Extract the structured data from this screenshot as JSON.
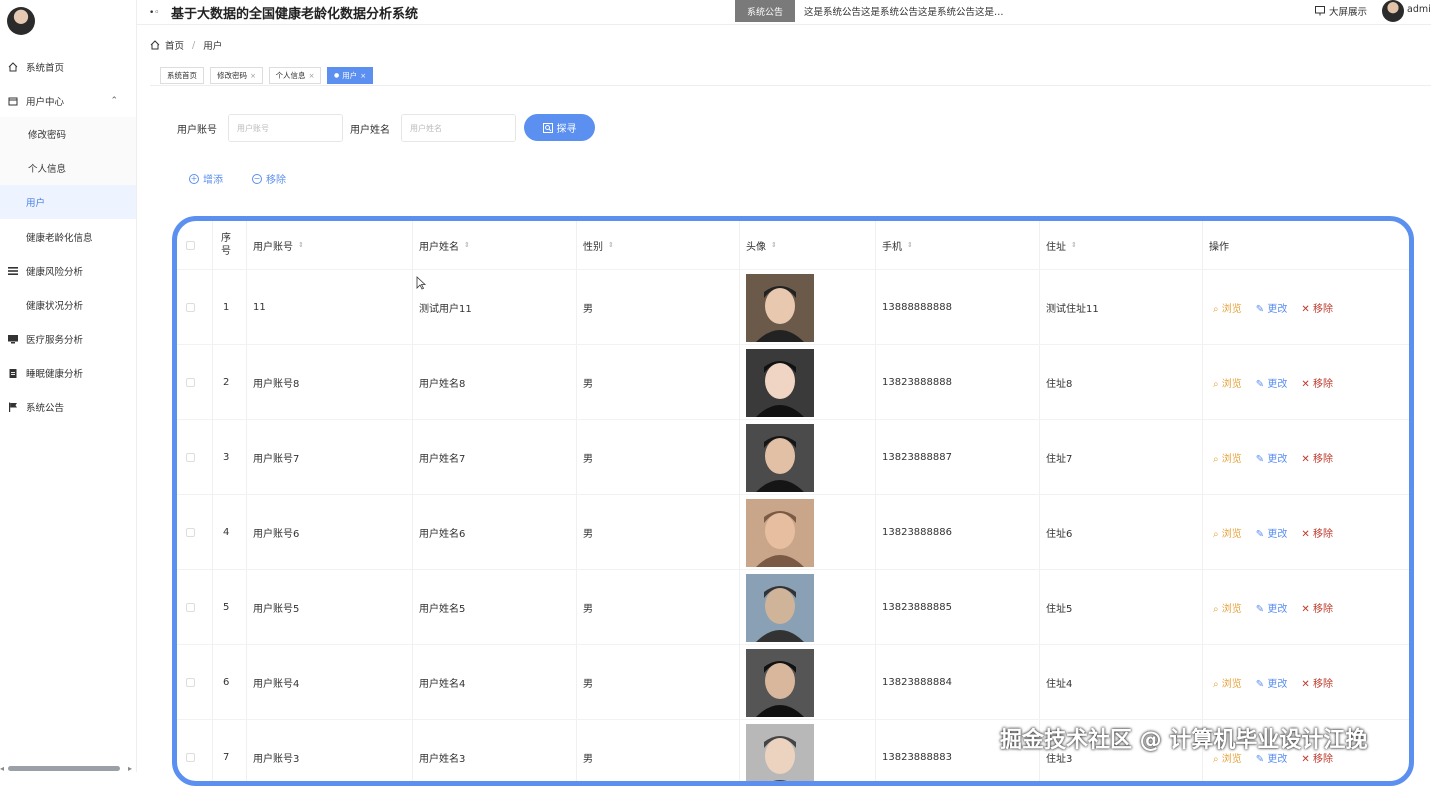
{
  "header": {
    "title": "基于大数据的全国健康老龄化数据分析系统",
    "notice_label": "系统公告",
    "notice_text": "这是系统公告这是系统公告这是系统公告这是…",
    "bigscreen_label": "大屏展示",
    "user_name": "admi"
  },
  "sidebar": {
    "items": [
      {
        "label": "系统首页",
        "icon": "home-icon"
      },
      {
        "label": "用户中心",
        "icon": "user-center-icon"
      },
      {
        "label": "修改密码"
      },
      {
        "label": "个人信息"
      },
      {
        "label": "用户",
        "icon": "grid-icon"
      },
      {
        "label": "健康老龄化信息",
        "icon": "grid-icon"
      },
      {
        "label": "健康风险分析",
        "icon": "list-icon"
      },
      {
        "label": "健康状况分析",
        "icon": "grid-icon"
      },
      {
        "label": "医疗服务分析",
        "icon": "monitor-icon"
      },
      {
        "label": "睡眠健康分析",
        "icon": "clipboard-icon"
      },
      {
        "label": "系统公告",
        "icon": "flag-icon"
      }
    ]
  },
  "breadcrumb": {
    "home": "首页",
    "current": "用户"
  },
  "tabs": [
    {
      "label": "系统首页"
    },
    {
      "label": "修改密码"
    },
    {
      "label": "个人信息"
    },
    {
      "label": "用户"
    }
  ],
  "search": {
    "account_label": "用户账号",
    "account_placeholder": "用户账号",
    "name_label": "用户姓名",
    "name_placeholder": "用户姓名",
    "button_label": "探寻"
  },
  "actions": {
    "add": "增添",
    "remove": "移除"
  },
  "table": {
    "headers": [
      "序号",
      "用户账号",
      "用户姓名",
      "性别",
      "头像",
      "手机",
      "住址",
      "操作"
    ],
    "op_view": "浏览",
    "op_edit": "更改",
    "op_delete": "移除",
    "rows": [
      {
        "no": "1",
        "account": "11",
        "name": "测试用户11",
        "gender": "男",
        "phone": "13888888888",
        "address": "测试住址11"
      },
      {
        "no": "2",
        "account": "用户账号8",
        "name": "用户姓名8",
        "gender": "男",
        "phone": "13823888888",
        "address": "住址8"
      },
      {
        "no": "3",
        "account": "用户账号7",
        "name": "用户姓名7",
        "gender": "男",
        "phone": "13823888887",
        "address": "住址7"
      },
      {
        "no": "4",
        "account": "用户账号6",
        "name": "用户姓名6",
        "gender": "男",
        "phone": "13823888886",
        "address": "住址6"
      },
      {
        "no": "5",
        "account": "用户账号5",
        "name": "用户姓名5",
        "gender": "男",
        "phone": "13823888885",
        "address": "住址5"
      },
      {
        "no": "6",
        "account": "用户账号4",
        "name": "用户姓名4",
        "gender": "男",
        "phone": "13823888884",
        "address": "住址4"
      },
      {
        "no": "7",
        "account": "用户账号3",
        "name": "用户姓名3",
        "gender": "男",
        "phone": "13823888883",
        "address": "住址3"
      }
    ]
  },
  "watermark": "掘金技术社区 @ 计算机毕业设计江挽",
  "colors": {
    "accent": "#5b8ff0",
    "view": "#e6a23c",
    "delete": "#c0392b"
  }
}
